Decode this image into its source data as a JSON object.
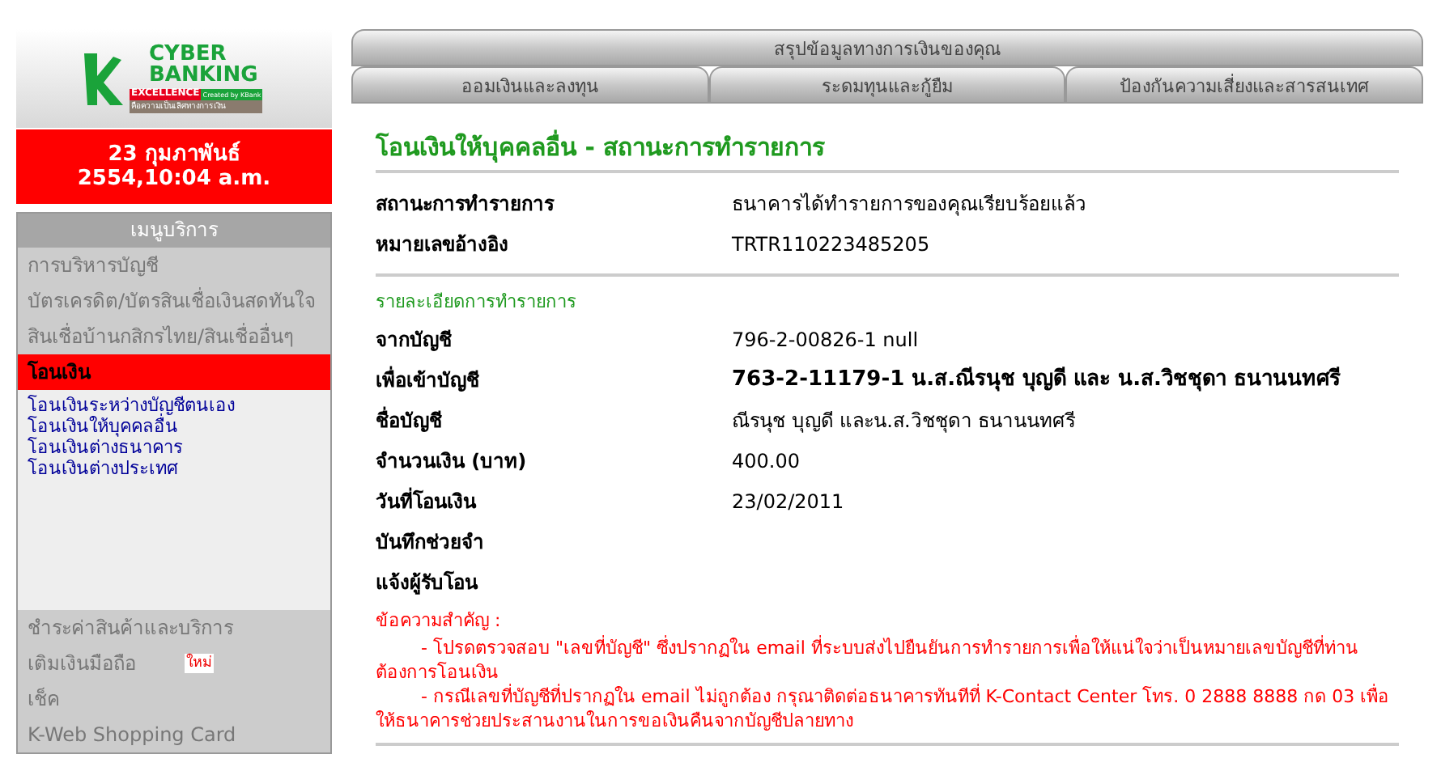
{
  "logo": {
    "line_1": "CYBER",
    "line_2": "BANKING",
    "badge": "EXCELLENCE",
    "credit": "Created by KBank",
    "tagline": "คือความเป็นเลิศทางการเงิน"
  },
  "datetime": "23 กุมภาพันธ์ 2554,10:04 a.m.",
  "menu": {
    "title": "เมนูบริการ",
    "items": [
      {
        "label": "การบริหารบัญชี",
        "selected": false
      },
      {
        "label": "บัตรเครดิต/บัตรสินเชื่อเงินสดทันใจ",
        "selected": false
      },
      {
        "label": "สินเชื่อบ้านกสิกรไทย/สินเชื่ออื่นๆ",
        "selected": false
      },
      {
        "label": "โอนเงิน",
        "selected": true,
        "children": [
          {
            "label": "โอนเงินระหว่างบัญชีตนเอง"
          },
          {
            "label": "โอนเงินให้บุคคลอื่น"
          },
          {
            "label": "โอนเงินต่างธนาคาร"
          },
          {
            "label": "โอนเงินต่างประเทศ"
          }
        ]
      },
      {
        "label": "ชำระค่าสินค้าและบริการ",
        "selected": false
      },
      {
        "label": "เติมเงินมือถือ",
        "selected": false,
        "badge": "ใหม่"
      },
      {
        "label": "เช็ค",
        "selected": false
      },
      {
        "label": "K-Web Shopping Card",
        "selected": false
      }
    ]
  },
  "tabs_top": [
    "สรุปข้อมูลทางการเงินของคุณ"
  ],
  "tabs": [
    "ออมเงินและลงทุน",
    "ระดมทุนและกู้ยืม",
    "ป้องกันความเสี่ยงและสารสนเทศ"
  ],
  "title": "โอนเงินให้บุคคลอื่น - สถานะการทำรายการ",
  "status_rows": [
    {
      "label": "สถานะการทำรายการ",
      "value": "ธนาคารได้ทำรายการของคุณเรียบร้อยแล้ว",
      "emphasis": false
    },
    {
      "label": "หมายเลขอ้างอิง",
      "value": "TRTR110223485205",
      "emphasis": false
    }
  ],
  "details_title": "รายละเอียดการทำรายการ",
  "detail_rows": [
    {
      "label": "จากบัญชี",
      "value": "796-2-00826-1 null",
      "emphasis": false
    },
    {
      "label": "เพื่อเข้าบัญชี",
      "value": "763-2-11179-1 น.ส.ณีรนุช บุญดี และ น.ส.วิชชุดา ธนานนทศรี",
      "emphasis": true
    },
    {
      "label": "ชื่อบัญชี",
      "value": "ณีรนุช บุญดี และน.ส.วิชชุดา ธนานนทศรี",
      "emphasis": false
    },
    {
      "label": "จำนวนเงิน (บาท)",
      "value": "400.00",
      "emphasis": false
    },
    {
      "label": "วันที่โอนเงิน",
      "value": "23/02/2011",
      "emphasis": false
    },
    {
      "label": "บันทึกช่วยจำ"
    },
    {
      "label": "แจ้งผู้รับโอน"
    }
  ],
  "notice": {
    "title": "ข้อความสำคัญ :",
    "items": [
      "- โปรดตรวจสอบ \"เลขที่บัญชี\" ซึ่งปรากฏใน email ที่ระบบส่งไปยืนยันการทำรายการเพื่อให้แน่ใจว่าเป็นหมายเลขบัญชีที่ท่านต้องการโอนเงิน",
      "- กรณีเลขที่บัญชีที่ปรากฏใน email ไม่ถูกต้อง กรุณาติดต่อธนาคารทันทีที่ K-Contact Center โทร. 0 2888 8888 กด 03 เพื่อให้ธนาคารช่วยประสานงานในการขอเงินคืนจากบัญชีปลายทาง"
    ]
  }
}
